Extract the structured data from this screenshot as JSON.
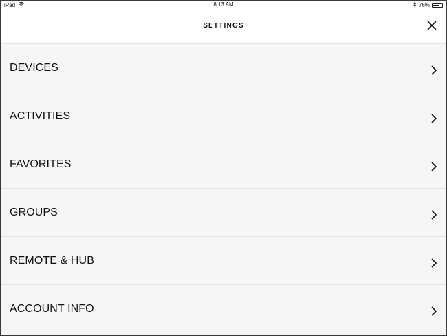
{
  "status_bar": {
    "device": "iPad",
    "time": "8:13 AM",
    "battery_percent": "76%",
    "battery_level": 0.76,
    "icons": [
      "wifi-icon",
      "bluetooth-icon",
      "battery-icon"
    ]
  },
  "header": {
    "title": "SETTINGS",
    "close_icon": "close-icon"
  },
  "menu": {
    "items": [
      {
        "label": "DEVICES",
        "icon": "chevron-right-icon"
      },
      {
        "label": "ACTIVITIES",
        "icon": "chevron-right-icon"
      },
      {
        "label": "FAVORITES",
        "icon": "chevron-right-icon"
      },
      {
        "label": "GROUPS",
        "icon": "chevron-right-icon"
      },
      {
        "label": "REMOTE & HUB",
        "icon": "chevron-right-icon"
      },
      {
        "label": "ACCOUNT INFO",
        "icon": "chevron-right-icon"
      }
    ]
  },
  "colors": {
    "background": "#f6f6f6",
    "header_background": "#ffffff",
    "text": "#111111",
    "divider": "#e2e2e2"
  }
}
